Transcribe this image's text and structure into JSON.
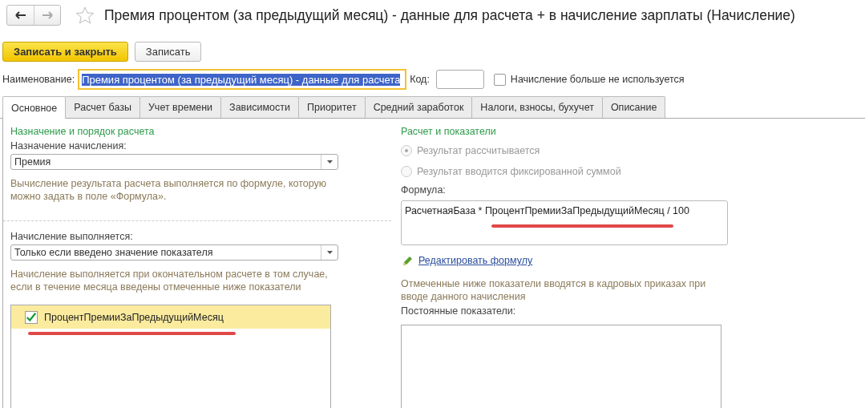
{
  "window": {
    "title": "Премия процентом (за предыдущий месяц) - данные для расчета + в начисление зарплаты (Начисление)",
    "favorite": false
  },
  "toolbar": {
    "buttons": [
      {
        "label": "Записать и закрыть",
        "kind": "primary"
      },
      {
        "label": "Записать",
        "kind": "normal"
      }
    ]
  },
  "name_field": {
    "label": "Наименование:",
    "value": "Премия процентом (за предыдущий месяц) - данные для расчета"
  },
  "code_field": {
    "label": "Код:"
  },
  "unused_checkbox": {
    "label": "Начисление больше не используется",
    "checked": false
  },
  "tabs": [
    {
      "label": "Основное",
      "selected": true
    },
    {
      "label": "Расчет базы",
      "selected": false
    },
    {
      "label": "Учет времени",
      "selected": false
    },
    {
      "label": "Зависимости",
      "selected": false
    },
    {
      "label": "Приоритет",
      "selected": false
    },
    {
      "label": "Средний заработок",
      "selected": false
    },
    {
      "label": "Налоги, взносы, бухучет",
      "selected": false
    },
    {
      "label": "Описание",
      "selected": false
    }
  ],
  "left": {
    "section_title": "Назначение и порядок расчета",
    "purpose_label": "Назначение начисления:",
    "purpose_value": "Премия",
    "purpose_hint": "Вычисление результата расчета выполняется по формуле, которую можно задать в поле «Формула».",
    "mode_label": "Начисление выполняется:",
    "mode_value": "Только если введено значение показателя",
    "mode_hint": "Начисление выполняется при окончательном расчете в том случае, если в течение месяца введены отмеченные ниже показатели",
    "indicators": [
      {
        "name": "ПроцентПремииЗаПредыдущийМесяц",
        "checked": true,
        "selected": true,
        "annotated": true
      }
    ]
  },
  "right": {
    "section_title": "Расчет и показатели",
    "result_options": [
      {
        "label": "Результат рассчитывается",
        "selected": true,
        "disabled": true
      },
      {
        "label": "Результат вводится фиксированной суммой",
        "selected": false,
        "disabled": true
      }
    ],
    "formula_label": "Формула:",
    "formula": "РасчетнаяБаза * ПроцентПремииЗаПредыдущийМесяц / 100",
    "formula_annotated": true,
    "edit_link": "Редактировать формулу",
    "indicators_hint": "Отмеченные ниже показатели вводятся в кадровых приказах при вводе данного начисления",
    "constant_label": "Постоянные показатели:"
  }
}
